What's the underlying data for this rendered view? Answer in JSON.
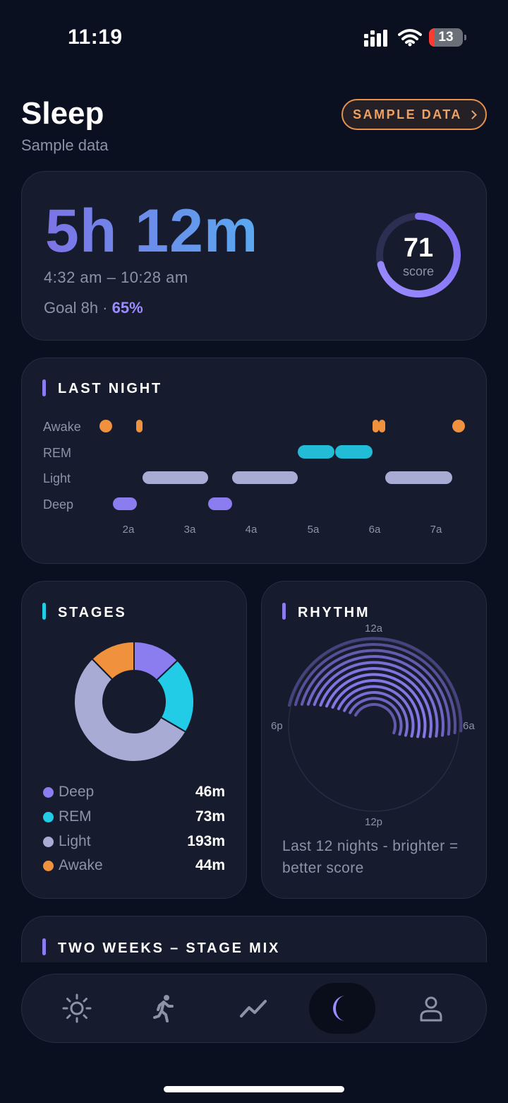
{
  "status_bar": {
    "time": "11:19",
    "battery": "13"
  },
  "header": {
    "title": "Sleep",
    "subtitle": "Sample data",
    "sample_button": "SAMPLE DATA"
  },
  "summary": {
    "duration": "5h 12m",
    "time_range": "4:32 am – 10:28 am",
    "goal_text": "Goal 8h · ",
    "goal_pct": "65%",
    "score": "71",
    "score_label": "score",
    "score_fraction": 0.71
  },
  "last_night": {
    "title": "LAST NIGHT",
    "stage_labels": [
      "Awake",
      "REM",
      "Light",
      "Deep"
    ],
    "time_ticks": [
      "2a",
      "3a",
      "4a",
      "5a",
      "6a",
      "7a"
    ]
  },
  "stages": {
    "title": "STAGES",
    "items": [
      {
        "name": "Deep",
        "value": "46m",
        "minutes": 46,
        "color": "#8b7cf0"
      },
      {
        "name": "REM",
        "value": "73m",
        "minutes": 73,
        "color": "#22cbe6"
      },
      {
        "name": "Light",
        "value": "193m",
        "minutes": 193,
        "color": "#a8acd4"
      },
      {
        "name": "Awake",
        "value": "44m",
        "minutes": 44,
        "color": "#f0913d"
      }
    ]
  },
  "rhythm": {
    "title": "RHYTHM",
    "labels": {
      "top": "12a",
      "right": "6a",
      "bottom": "12p",
      "left": "6p"
    },
    "caption": "Last 12 nights - brighter = better score"
  },
  "two_weeks": {
    "title": "TWO WEEKS – STAGE MIX"
  },
  "colors": {
    "accent_purple": "#8b7cf0",
    "accent_cyan": "#22cbe6",
    "accent_orange": "#f0913d",
    "light_stage": "#a8acd4"
  },
  "nav": {
    "items": [
      {
        "icon": "sun-icon"
      },
      {
        "icon": "running-figure-icon"
      },
      {
        "icon": "trend-line-icon"
      },
      {
        "icon": "moon-icon",
        "active": true
      },
      {
        "icon": "person-icon"
      }
    ]
  }
}
